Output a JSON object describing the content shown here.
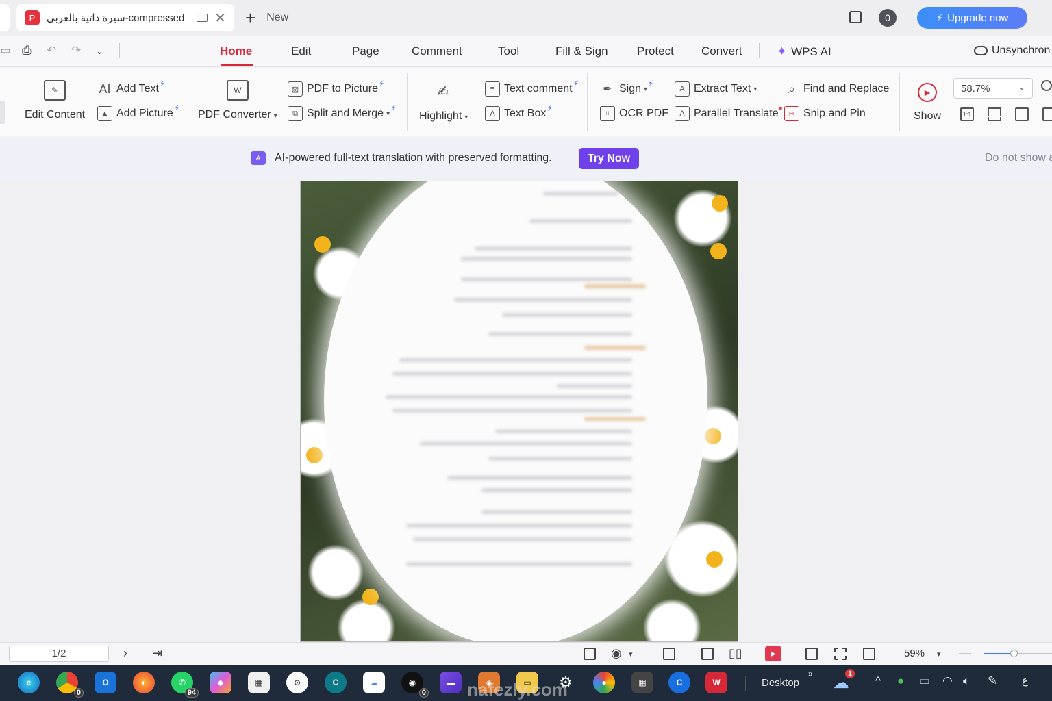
{
  "titlebar": {
    "tab_title": "سيرة ذاتية بالعربى-compressed",
    "new_tab_label": "New",
    "notification_count": "0",
    "upgrade_label": "Upgrade now"
  },
  "menu": {
    "items": [
      "Home",
      "Edit",
      "Page",
      "Comment",
      "Tool",
      "Fill & Sign",
      "Protect",
      "Convert"
    ],
    "active": "Home",
    "wps_ai": "WPS AI",
    "sync_status": "Unsynchron"
  },
  "ribbon": {
    "edit_content": "Edit Content",
    "add_text": "Add Text",
    "add_picture": "Add Picture",
    "pdf_converter": "PDF Converter",
    "pdf_to_picture": "PDF to Picture",
    "split_and_merge": "Split and Merge",
    "highlight": "Highlight",
    "text_comment": "Text comment",
    "text_box": "Text Box",
    "sign": "Sign",
    "ocr_pdf": "OCR PDF",
    "extract_text": "Extract Text",
    "parallel_translate": "Parallel Translate",
    "find_and_replace": "Find and Replace",
    "snip_and_pin": "Snip and Pin",
    "show": "Show",
    "zoom_value": "58.7%"
  },
  "notice": {
    "message": "AI-powered full-text translation with preserved formatting.",
    "try_now": "Try Now",
    "dismiss": "Do not show a"
  },
  "statusbar": {
    "page_indicator": "1/2",
    "zoom": "59%"
  },
  "taskbar": {
    "chrome_badge": "0",
    "whatsapp_badge": "94",
    "github_badge": "0",
    "desktop_label": "Desktop",
    "weather_badge": "1",
    "lang": "ع"
  },
  "watermark": "nafezly.com",
  "colors": {
    "accent_red": "#d7283a",
    "upgrade_blue": "#3b8ff8",
    "try_now_purple": "#7040ea",
    "taskbar_bg": "#1f2a3a"
  }
}
